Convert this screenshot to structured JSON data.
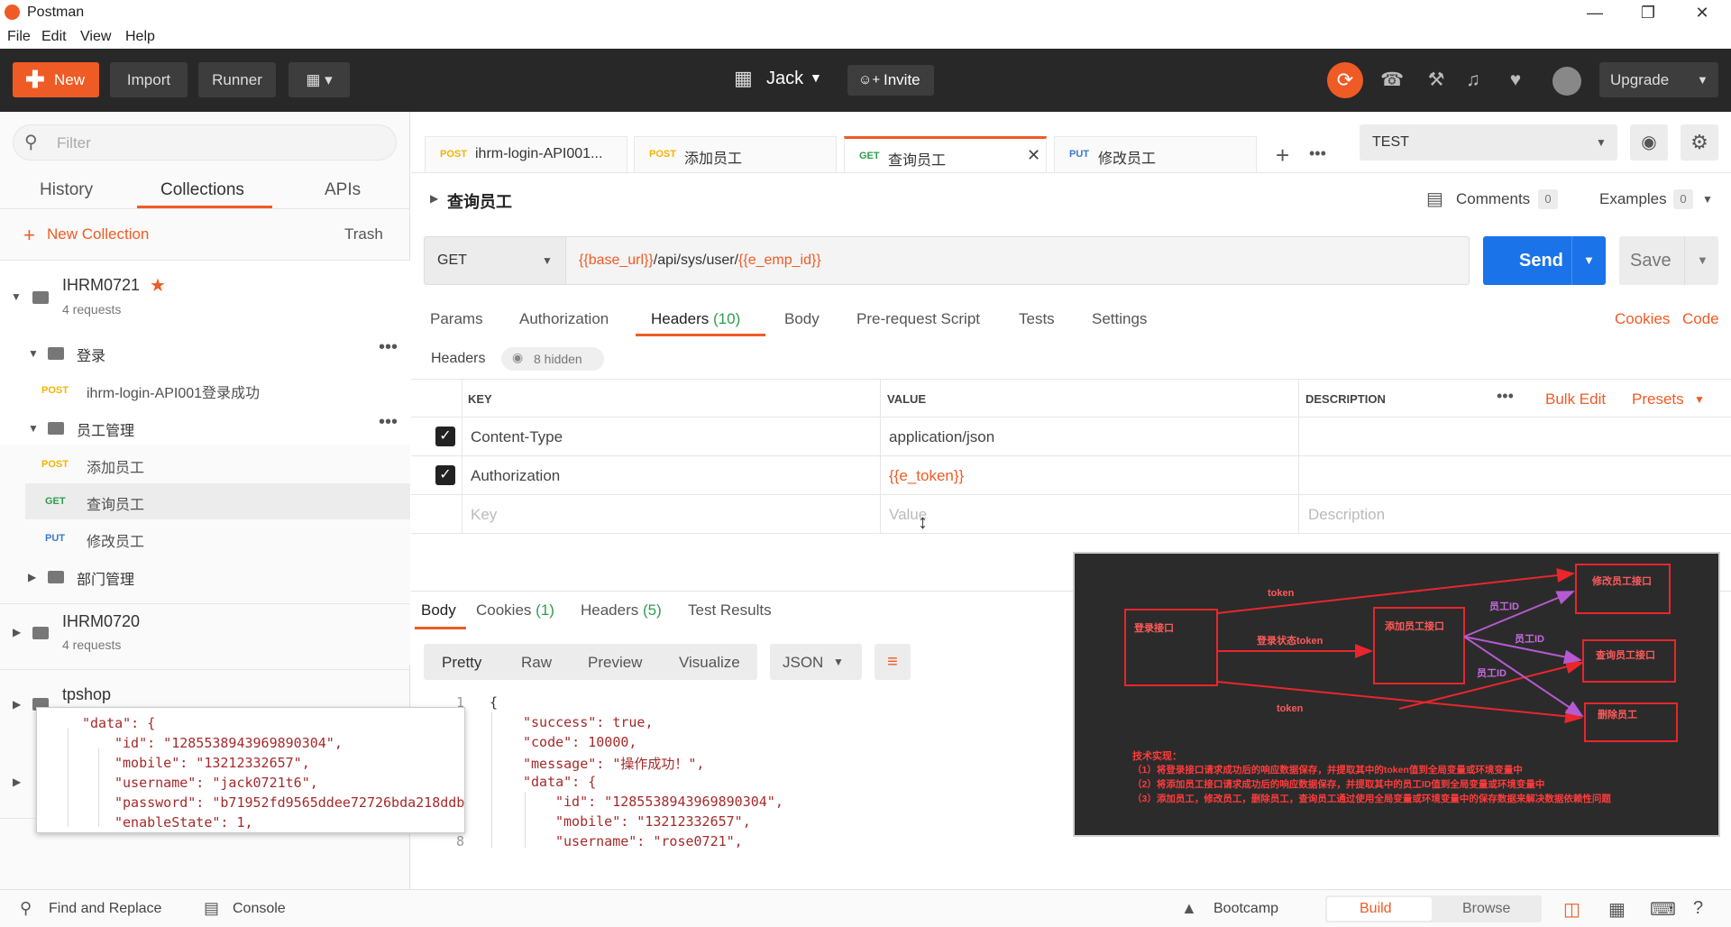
{
  "window": {
    "title": "Postman"
  },
  "menu": [
    "File",
    "Edit",
    "View",
    "Help"
  ],
  "toolbar": {
    "new_label": "New",
    "import_label": "Import",
    "runner_label": "Runner",
    "workspace": "Jack",
    "invite_label": "Invite",
    "upgrade_label": "Upgrade"
  },
  "sidebar": {
    "filter_placeholder": "Filter",
    "tabs": [
      "History",
      "Collections",
      "APIs"
    ],
    "new_collection": "New Collection",
    "trash": "Trash",
    "collections": [
      {
        "name": "IHRM0721",
        "count": "4 requests"
      },
      {
        "name": "IHRM0720",
        "count": "4 requests"
      },
      {
        "name": "tpshop"
      }
    ],
    "folders": [
      "登录",
      "员工管理",
      "部门管理"
    ],
    "requests": [
      {
        "method": "POST",
        "name": "ihrm-login-API001登录成功"
      },
      {
        "method": "POST",
        "name": "添加员工"
      },
      {
        "method": "GET",
        "name": "查询员工"
      },
      {
        "method": "PUT",
        "name": "修改员工"
      }
    ]
  },
  "tabs": [
    {
      "method": "POST",
      "name": "ihrm-login-API001..."
    },
    {
      "method": "POST",
      "name": "添加员工"
    },
    {
      "method": "GET",
      "name": "查询员工"
    },
    {
      "method": "PUT",
      "name": "修改员工"
    }
  ],
  "environment": "TEST",
  "request": {
    "title": "查询员工",
    "comments_label": "Comments",
    "comments_count": "0",
    "examples_label": "Examples",
    "examples_count": "0",
    "method": "GET",
    "url_var1": "{{base_url}}",
    "url_mid": "/api/sys/user/",
    "url_var2": "{{e_emp_id}}",
    "send": "Send",
    "save": "Save",
    "subtabs": [
      "Params",
      "Authorization",
      "Headers",
      "(10)",
      "Body",
      "Pre-request Script",
      "Tests",
      "Settings"
    ],
    "cookies": "Cookies",
    "code": "Code",
    "headers_label": "Headers",
    "hidden": "8 hidden",
    "cols": [
      "KEY",
      "VALUE",
      "DESCRIPTION"
    ],
    "bulk_edit": "Bulk Edit",
    "presets": "Presets",
    "rows": [
      {
        "key": "Content-Type",
        "value": "application/json"
      },
      {
        "key": "Authorization",
        "value": "{{e_token}}"
      }
    ],
    "placeholders": {
      "key": "Key",
      "value": "Value",
      "description": "Description"
    }
  },
  "response": {
    "tabs": [
      "Body",
      "Cookies",
      "(1)",
      "Headers",
      "(5)",
      "Test Results"
    ],
    "views": [
      "Pretty",
      "Raw",
      "Preview",
      "Visualize"
    ],
    "format": "JSON",
    "line_numbers": [
      "1",
      "8"
    ],
    "lines": [
      "{",
      "\"success\": true,",
      "\"code\": 10000,",
      "\"message\": \"操作成功！\",",
      "\"data\": {",
      "\"id\": \"1285538943969890304\",",
      "\"mobile\": \"13212332657\",",
      "\"username\": \"rose0721\","
    ]
  },
  "popup": {
    "lines": [
      "\"data\": {",
      "\"id\": \"1285538943969890304\",",
      "\"mobile\": \"13212332657\",",
      "\"username\": \"jack0721t6\",",
      "\"password\": \"b71952fd9565ddee72726bda218ddb",
      "\"enableState\": 1,"
    ]
  },
  "diagram": {
    "boxes": [
      "登录接口",
      "添加员工接口",
      "修改员工接口",
      "查询员工接口",
      "删除员工"
    ],
    "labels": [
      "token",
      "登录状态token",
      "token",
      "员工ID",
      "员工ID",
      "员工ID"
    ],
    "notes": [
      "技术实现：",
      "（1）将登录接口请求成功后的响应数据保存，并提取其中的token值到全局变量或环境变量中",
      "（2）将添加员工接口请求成功后的响应数据保存，并提取其中的员工ID值到全局变量或环境变量中",
      "（3）添加员工，修改员工，删除员工，查询员工通过使用全局变量或环境变量中的保存数据来解决数据依赖性问题"
    ]
  },
  "statusbar": {
    "find": "Find and Replace",
    "console": "Console",
    "bootcamp": "Bootcamp",
    "build": "Build",
    "browse": "Browse"
  },
  "colors": {
    "accent": "#ef5b25",
    "send": "#1a73e8",
    "post": "#f4b400",
    "get": "#2e9d4e",
    "put": "#3a78c8"
  }
}
